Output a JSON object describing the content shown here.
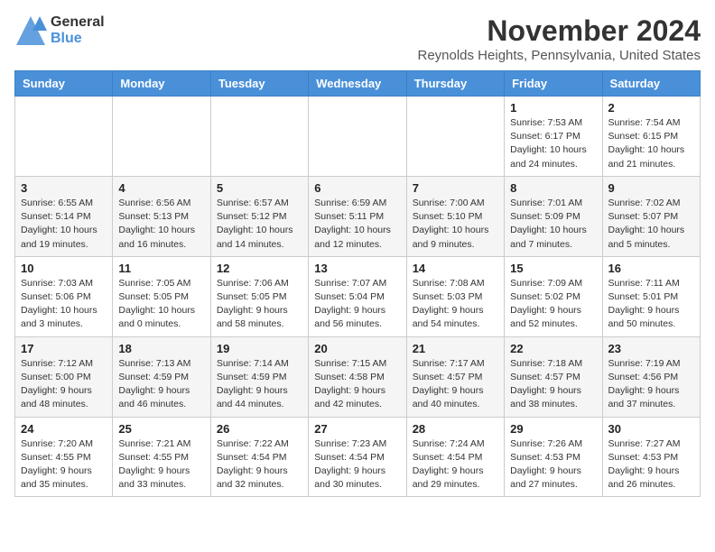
{
  "header": {
    "logo_general": "General",
    "logo_blue": "Blue",
    "month_title": "November 2024",
    "location": "Reynolds Heights, Pennsylvania, United States"
  },
  "weekdays": [
    "Sunday",
    "Monday",
    "Tuesday",
    "Wednesday",
    "Thursday",
    "Friday",
    "Saturday"
  ],
  "weeks": [
    [
      {
        "day": "",
        "info": ""
      },
      {
        "day": "",
        "info": ""
      },
      {
        "day": "",
        "info": ""
      },
      {
        "day": "",
        "info": ""
      },
      {
        "day": "",
        "info": ""
      },
      {
        "day": "1",
        "info": "Sunrise: 7:53 AM\nSunset: 6:17 PM\nDaylight: 10 hours\nand 24 minutes."
      },
      {
        "day": "2",
        "info": "Sunrise: 7:54 AM\nSunset: 6:15 PM\nDaylight: 10 hours\nand 21 minutes."
      }
    ],
    [
      {
        "day": "3",
        "info": "Sunrise: 6:55 AM\nSunset: 5:14 PM\nDaylight: 10 hours\nand 19 minutes."
      },
      {
        "day": "4",
        "info": "Sunrise: 6:56 AM\nSunset: 5:13 PM\nDaylight: 10 hours\nand 16 minutes."
      },
      {
        "day": "5",
        "info": "Sunrise: 6:57 AM\nSunset: 5:12 PM\nDaylight: 10 hours\nand 14 minutes."
      },
      {
        "day": "6",
        "info": "Sunrise: 6:59 AM\nSunset: 5:11 PM\nDaylight: 10 hours\nand 12 minutes."
      },
      {
        "day": "7",
        "info": "Sunrise: 7:00 AM\nSunset: 5:10 PM\nDaylight: 10 hours\nand 9 minutes."
      },
      {
        "day": "8",
        "info": "Sunrise: 7:01 AM\nSunset: 5:09 PM\nDaylight: 10 hours\nand 7 minutes."
      },
      {
        "day": "9",
        "info": "Sunrise: 7:02 AM\nSunset: 5:07 PM\nDaylight: 10 hours\nand 5 minutes."
      }
    ],
    [
      {
        "day": "10",
        "info": "Sunrise: 7:03 AM\nSunset: 5:06 PM\nDaylight: 10 hours\nand 3 minutes."
      },
      {
        "day": "11",
        "info": "Sunrise: 7:05 AM\nSunset: 5:05 PM\nDaylight: 10 hours\nand 0 minutes."
      },
      {
        "day": "12",
        "info": "Sunrise: 7:06 AM\nSunset: 5:05 PM\nDaylight: 9 hours\nand 58 minutes."
      },
      {
        "day": "13",
        "info": "Sunrise: 7:07 AM\nSunset: 5:04 PM\nDaylight: 9 hours\nand 56 minutes."
      },
      {
        "day": "14",
        "info": "Sunrise: 7:08 AM\nSunset: 5:03 PM\nDaylight: 9 hours\nand 54 minutes."
      },
      {
        "day": "15",
        "info": "Sunrise: 7:09 AM\nSunset: 5:02 PM\nDaylight: 9 hours\nand 52 minutes."
      },
      {
        "day": "16",
        "info": "Sunrise: 7:11 AM\nSunset: 5:01 PM\nDaylight: 9 hours\nand 50 minutes."
      }
    ],
    [
      {
        "day": "17",
        "info": "Sunrise: 7:12 AM\nSunset: 5:00 PM\nDaylight: 9 hours\nand 48 minutes."
      },
      {
        "day": "18",
        "info": "Sunrise: 7:13 AM\nSunset: 4:59 PM\nDaylight: 9 hours\nand 46 minutes."
      },
      {
        "day": "19",
        "info": "Sunrise: 7:14 AM\nSunset: 4:59 PM\nDaylight: 9 hours\nand 44 minutes."
      },
      {
        "day": "20",
        "info": "Sunrise: 7:15 AM\nSunset: 4:58 PM\nDaylight: 9 hours\nand 42 minutes."
      },
      {
        "day": "21",
        "info": "Sunrise: 7:17 AM\nSunset: 4:57 PM\nDaylight: 9 hours\nand 40 minutes."
      },
      {
        "day": "22",
        "info": "Sunrise: 7:18 AM\nSunset: 4:57 PM\nDaylight: 9 hours\nand 38 minutes."
      },
      {
        "day": "23",
        "info": "Sunrise: 7:19 AM\nSunset: 4:56 PM\nDaylight: 9 hours\nand 37 minutes."
      }
    ],
    [
      {
        "day": "24",
        "info": "Sunrise: 7:20 AM\nSunset: 4:55 PM\nDaylight: 9 hours\nand 35 minutes."
      },
      {
        "day": "25",
        "info": "Sunrise: 7:21 AM\nSunset: 4:55 PM\nDaylight: 9 hours\nand 33 minutes."
      },
      {
        "day": "26",
        "info": "Sunrise: 7:22 AM\nSunset: 4:54 PM\nDaylight: 9 hours\nand 32 minutes."
      },
      {
        "day": "27",
        "info": "Sunrise: 7:23 AM\nSunset: 4:54 PM\nDaylight: 9 hours\nand 30 minutes."
      },
      {
        "day": "28",
        "info": "Sunrise: 7:24 AM\nSunset: 4:54 PM\nDaylight: 9 hours\nand 29 minutes."
      },
      {
        "day": "29",
        "info": "Sunrise: 7:26 AM\nSunset: 4:53 PM\nDaylight: 9 hours\nand 27 minutes."
      },
      {
        "day": "30",
        "info": "Sunrise: 7:27 AM\nSunset: 4:53 PM\nDaylight: 9 hours\nand 26 minutes."
      }
    ]
  ]
}
